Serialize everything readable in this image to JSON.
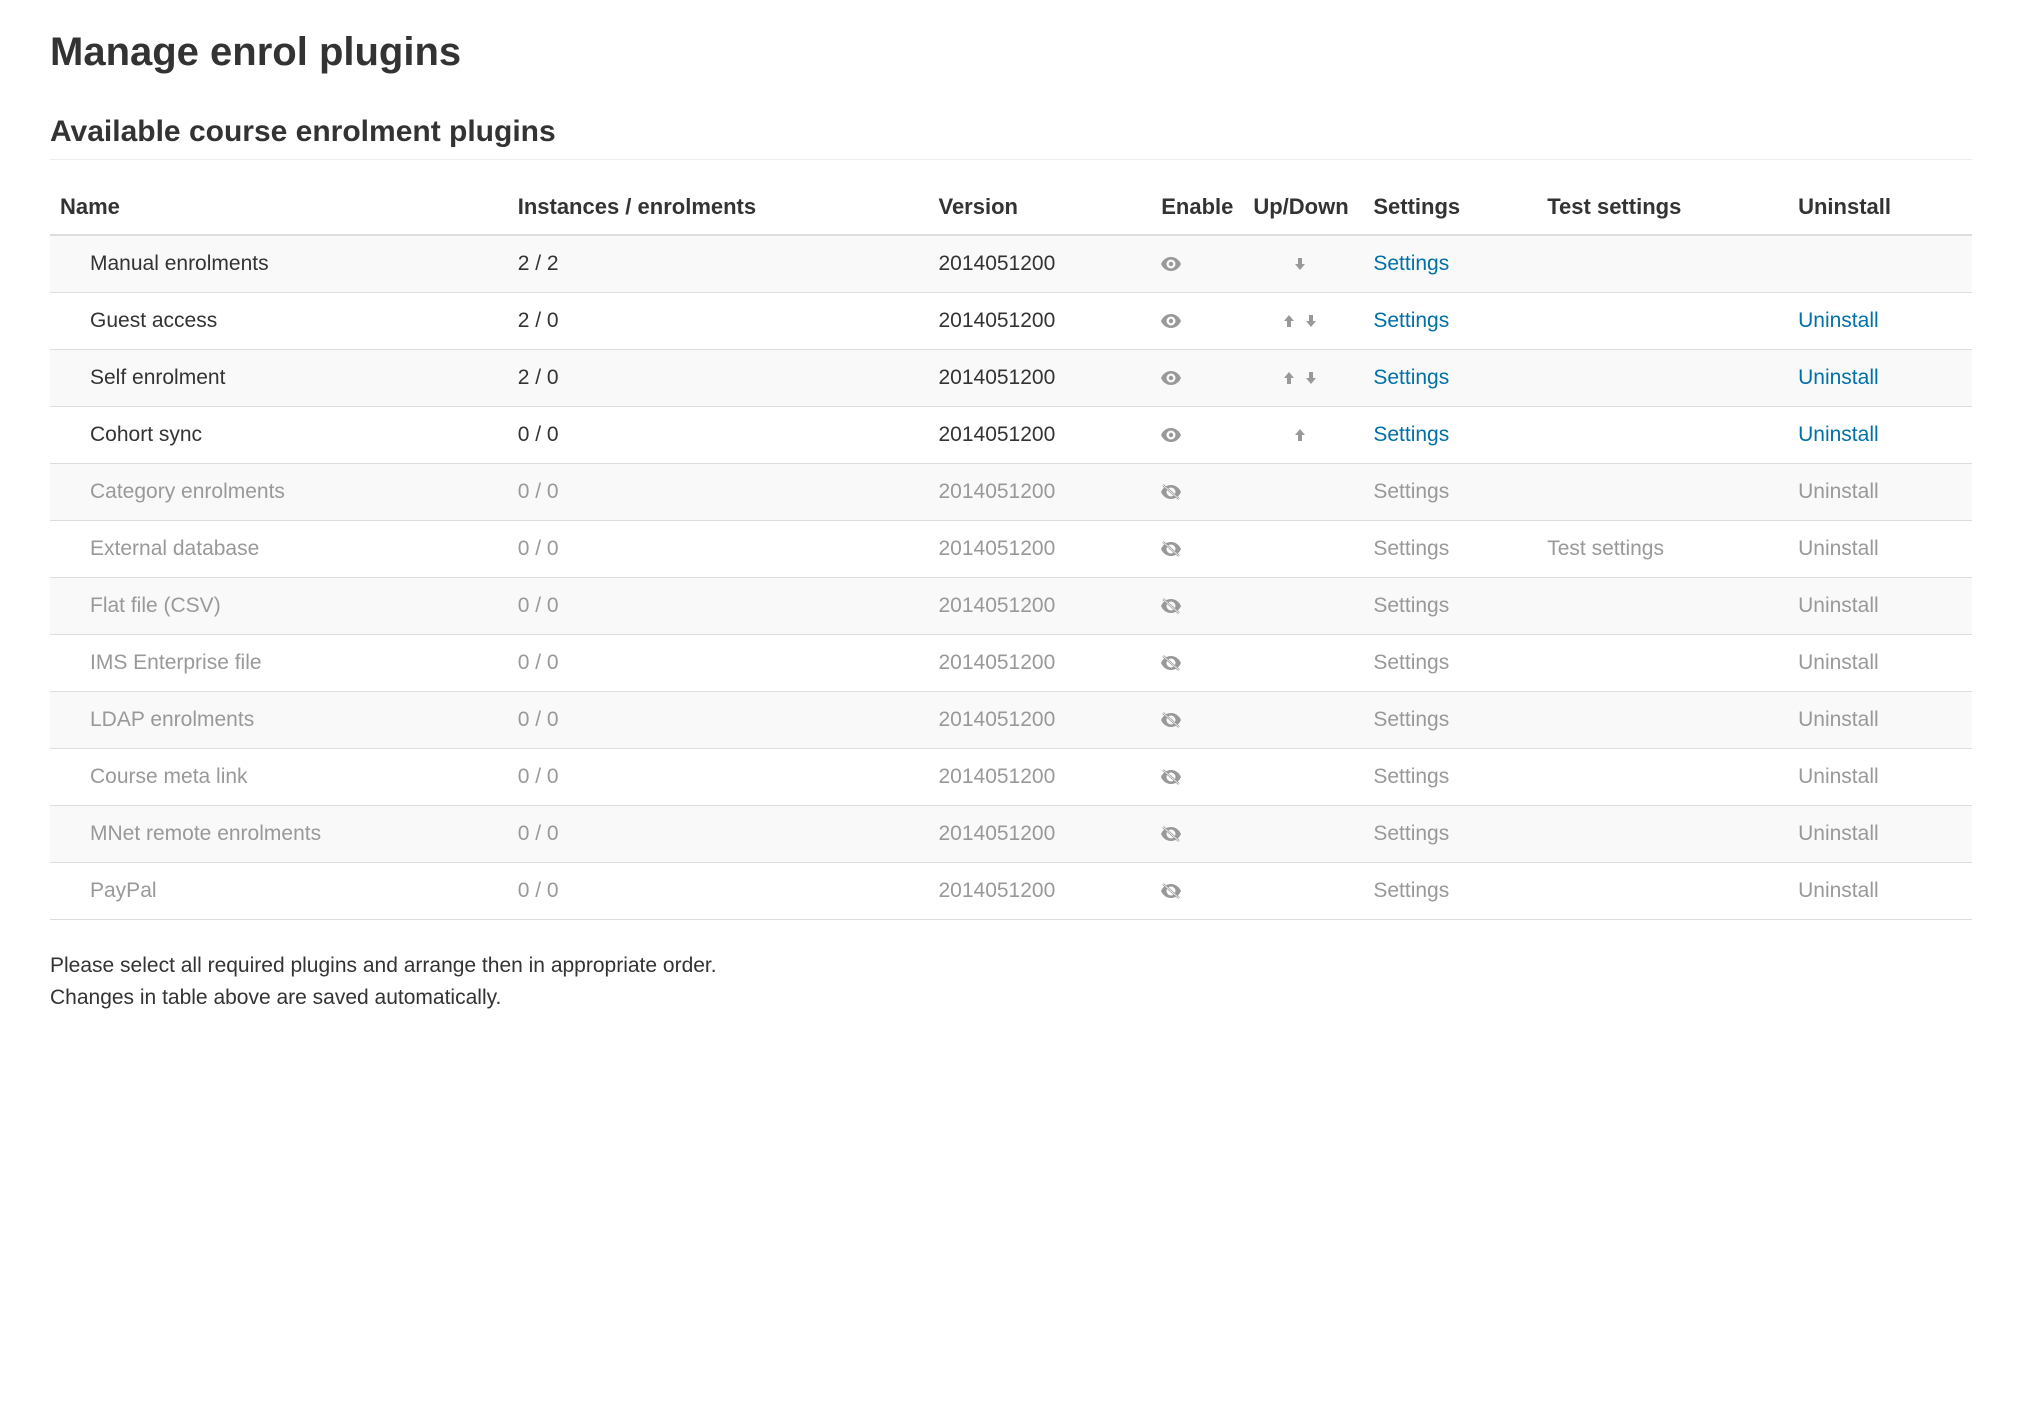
{
  "page_title": "Manage enrol plugins",
  "section_title": "Available course enrolment plugins",
  "columns": {
    "name": "Name",
    "instances": "Instances / enrolments",
    "version": "Version",
    "enable": "Enable",
    "updown": "Up/Down",
    "settings": "Settings",
    "test": "Test settings",
    "uninstall": "Uninstall"
  },
  "labels": {
    "settings": "Settings",
    "test_settings": "Test settings",
    "uninstall": "Uninstall"
  },
  "plugins": [
    {
      "name": "Manual enrolments",
      "instances": "2 / 2",
      "version": "2014051200",
      "enabled": true,
      "up": false,
      "down": true,
      "settings": true,
      "test": false,
      "uninstall": false
    },
    {
      "name": "Guest access",
      "instances": "2 / 0",
      "version": "2014051200",
      "enabled": true,
      "up": true,
      "down": true,
      "settings": true,
      "test": false,
      "uninstall": true
    },
    {
      "name": "Self enrolment",
      "instances": "2 / 0",
      "version": "2014051200",
      "enabled": true,
      "up": true,
      "down": true,
      "settings": true,
      "test": false,
      "uninstall": true
    },
    {
      "name": "Cohort sync",
      "instances": "0 / 0",
      "version": "2014051200",
      "enabled": true,
      "up": true,
      "down": false,
      "settings": true,
      "test": false,
      "uninstall": true
    },
    {
      "name": "Category enrolments",
      "instances": "0 / 0",
      "version": "2014051200",
      "enabled": false,
      "up": false,
      "down": false,
      "settings": true,
      "test": false,
      "uninstall": true
    },
    {
      "name": "External database",
      "instances": "0 / 0",
      "version": "2014051200",
      "enabled": false,
      "up": false,
      "down": false,
      "settings": true,
      "test": true,
      "uninstall": true
    },
    {
      "name": "Flat file (CSV)",
      "instances": "0 / 0",
      "version": "2014051200",
      "enabled": false,
      "up": false,
      "down": false,
      "settings": true,
      "test": false,
      "uninstall": true
    },
    {
      "name": "IMS Enterprise file",
      "instances": "0 / 0",
      "version": "2014051200",
      "enabled": false,
      "up": false,
      "down": false,
      "settings": true,
      "test": false,
      "uninstall": true
    },
    {
      "name": "LDAP enrolments",
      "instances": "0 / 0",
      "version": "2014051200",
      "enabled": false,
      "up": false,
      "down": false,
      "settings": true,
      "test": false,
      "uninstall": true
    },
    {
      "name": "Course meta link",
      "instances": "0 / 0",
      "version": "2014051200",
      "enabled": false,
      "up": false,
      "down": false,
      "settings": true,
      "test": false,
      "uninstall": true
    },
    {
      "name": "MNet remote enrolments",
      "instances": "0 / 0",
      "version": "2014051200",
      "enabled": false,
      "up": false,
      "down": false,
      "settings": true,
      "test": false,
      "uninstall": true
    },
    {
      "name": "PayPal",
      "instances": "0 / 0",
      "version": "2014051200",
      "enabled": false,
      "up": false,
      "down": false,
      "settings": true,
      "test": false,
      "uninstall": true
    }
  ],
  "footer_line1": "Please select all required plugins and arrange then in appropriate order.",
  "footer_line2": "Changes in table above are saved automatically."
}
